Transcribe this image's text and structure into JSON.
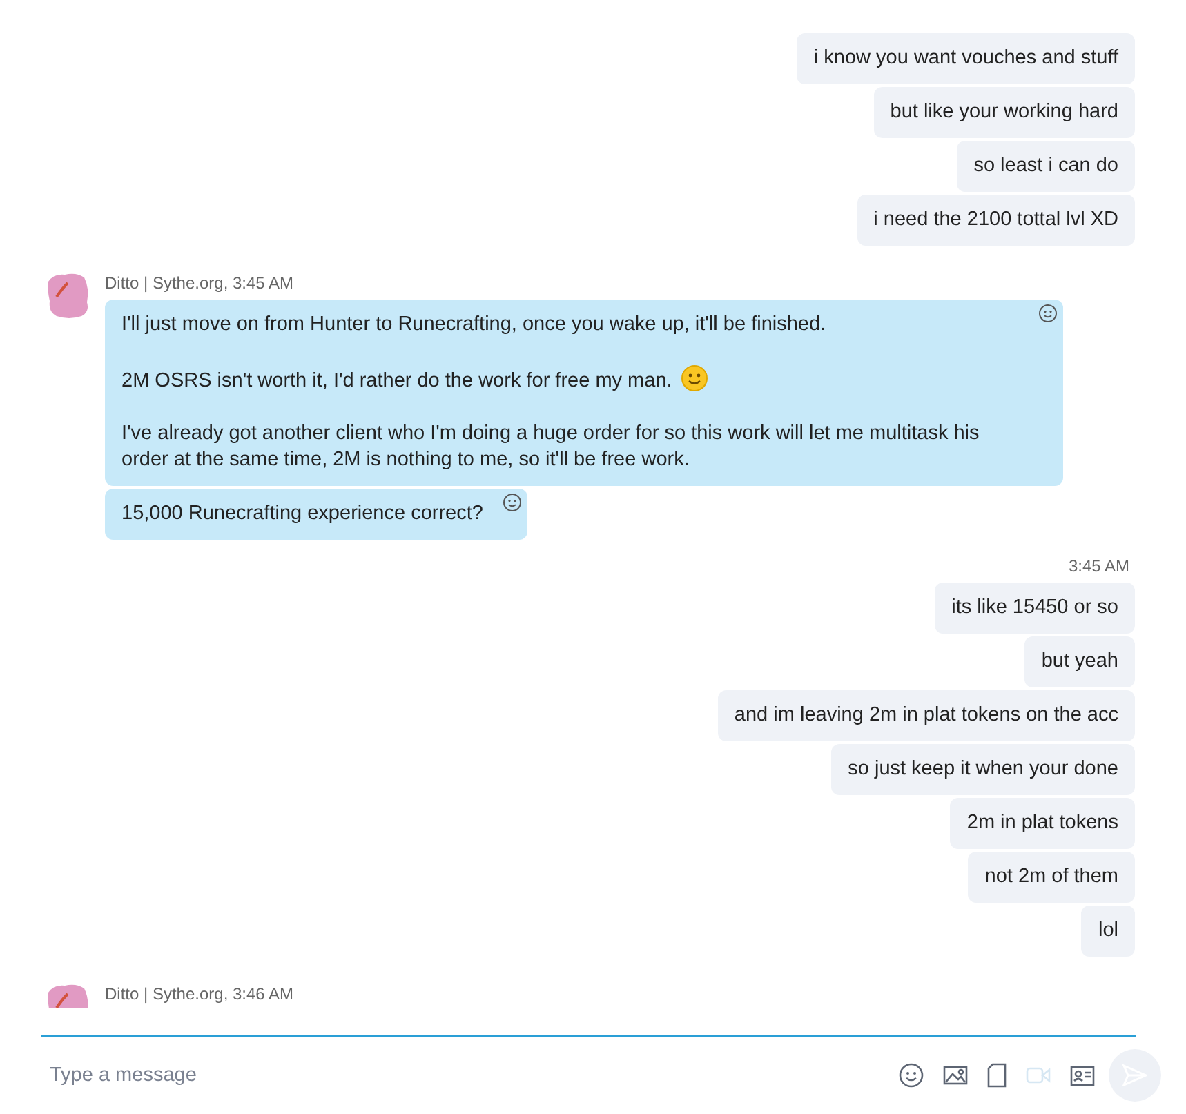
{
  "messages": [
    {
      "kind": "outgoing",
      "bubbles": [
        {
          "paragraphs": [
            {
              "text": "i know you want vouches and stuff",
              "emoji": false
            }
          ]
        },
        {
          "paragraphs": [
            {
              "text": "but like your working hard",
              "emoji": false
            }
          ]
        },
        {
          "paragraphs": [
            {
              "text": "so least i can do",
              "emoji": false
            }
          ]
        },
        {
          "paragraphs": [
            {
              "text": "i need the 2100 tottal lvl XD",
              "emoji": false
            }
          ]
        }
      ]
    },
    {
      "kind": "incoming",
      "sender": "Ditto | Sythe.org, 3:45 AM",
      "bubbles": [
        {
          "paragraphs": [
            {
              "text": "I'll just move on from Hunter to Runecrafting, once you wake up, it'll be finished.",
              "emoji": false
            },
            {
              "text": "2M OSRS isn't worth it, I'd rather do the work for free my man.",
              "emoji": true
            },
            {
              "text": "I've already got another client who I'm doing a huge order for so this work will let me multitask his order at the same time, 2M is nothing to me, so it'll be free work.",
              "emoji": false
            }
          ]
        },
        {
          "paragraphs": [
            {
              "text": "15,000 Runecrafting experience correct?",
              "emoji": false
            }
          ]
        }
      ]
    },
    {
      "kind": "outgoing",
      "time": "3:45 AM",
      "bubbles": [
        {
          "paragraphs": [
            {
              "text": "its like 15450 or so",
              "emoji": false
            }
          ]
        },
        {
          "paragraphs": [
            {
              "text": "but yeah",
              "emoji": false
            }
          ]
        },
        {
          "paragraphs": [
            {
              "text": "and im leaving 2m in plat tokens on the acc",
              "emoji": false
            }
          ]
        },
        {
          "paragraphs": [
            {
              "text": "so just keep it when your done",
              "emoji": false
            }
          ]
        },
        {
          "paragraphs": [
            {
              "text": "2m in plat tokens",
              "emoji": false
            }
          ]
        },
        {
          "paragraphs": [
            {
              "text": "not 2m of them",
              "emoji": false
            }
          ]
        },
        {
          "paragraphs": [
            {
              "text": "lol",
              "emoji": false
            }
          ]
        }
      ]
    },
    {
      "kind": "incoming",
      "sender": "Ditto | Sythe.org, 3:46 AM"
    }
  ],
  "composer": {
    "placeholder": "Type a message"
  }
}
